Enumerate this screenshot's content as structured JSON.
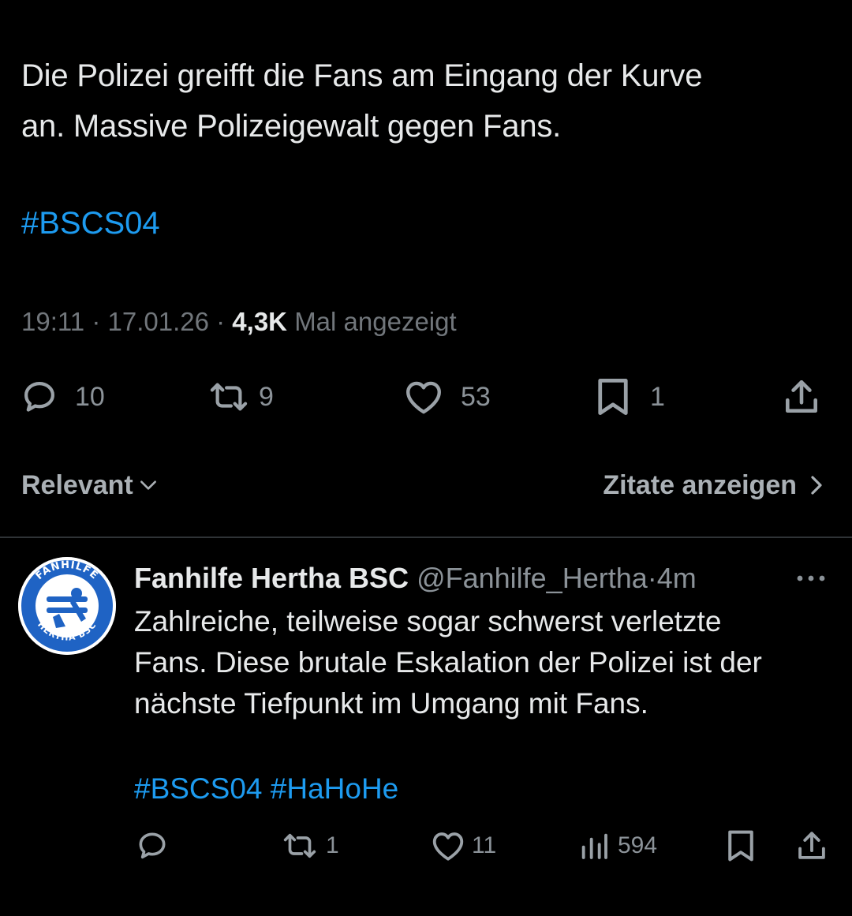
{
  "main_tweet": {
    "text_line1": "Die Polizei greifft die Fans am Eingang der Kurve",
    "text_line2": "an. Massive Polizeigewalt gegen Fans.",
    "hashtag": "#BSCS04",
    "time": "19:11",
    "date": "17.01.26",
    "separator": "·",
    "views_count": "4,3K",
    "views_label": "Mal angezeigt",
    "actions": {
      "replies": "10",
      "reposts": "9",
      "likes": "53",
      "bookmarks": "1"
    }
  },
  "filter": {
    "sort_label": "Relevant",
    "quotes_label": "Zitate anzeigen"
  },
  "reply": {
    "name": "Fanhilfe Hertha BSC",
    "handle": "@Fanhilfe_Hertha",
    "separator": "·",
    "time_ago": "4m",
    "text_line1": "Zahlreiche, teilweise sogar schwerst verletzte",
    "text_line2": "Fans. Diese brutale Eskalation der Polizei ist der",
    "text_line3": "nächste Tiefpunkt im Umgang mit Fans.",
    "hashtags": [
      "#BSCS04",
      "#HaHoHe"
    ],
    "actions": {
      "reposts": "1",
      "likes": "11",
      "views": "594"
    },
    "avatar_text_top": "FANHILFE",
    "avatar_text_bottom": "HERTHA BSC"
  },
  "colors": {
    "background": "#000000",
    "text": "#e7e9ea",
    "muted": "#71767b",
    "link": "#1d9bf0",
    "divider": "#2f3336",
    "avatar_blue": "#1f63c4"
  },
  "icons": {
    "reply": "speech-bubble-icon",
    "repost": "repost-arrows-icon",
    "like": "heart-icon",
    "bookmark": "bookmark-icon",
    "share": "share-upload-icon",
    "views": "bar-chart-icon",
    "more": "more-dots-icon",
    "chevron_down": "chevron-down-icon",
    "chevron_right": "chevron-right-icon"
  }
}
